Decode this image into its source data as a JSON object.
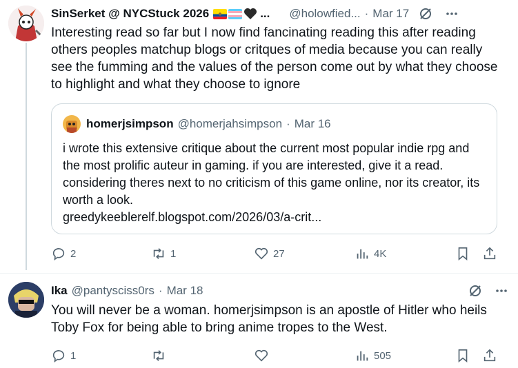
{
  "post1": {
    "display_name": "SinSerket @ NYCStuck 2026",
    "handle": "@holowfied...",
    "separator": "·",
    "time": "Mar 17",
    "text": "Interesting read so far but I now find fancinating reading this after reading others peoples matchup blogs or critques of media because you can really see the fumming and the values of the person come out by what they choose to highlight and what they choose to ignore",
    "quote": {
      "display_name": "homerjsimpson",
      "handle": "@homerjahsimpson",
      "separator": "·",
      "time": "Mar 16",
      "text": "i wrote this extensive critique about the current most popular indie rpg and the most prolific auteur in gaming. if you are interested, give it a read. considering theres next to no criticism of this game online, nor its creator, its worth a look.",
      "link": "greedykeeblerelf.blogspot.com/2026/03/a-crit..."
    },
    "actions": {
      "replies": "2",
      "reposts": "1",
      "likes": "27",
      "views": "4K"
    }
  },
  "post2": {
    "display_name": "Ika",
    "handle": "@pantysciss0rs",
    "separator": "·",
    "time": "Mar 18",
    "text": "You will never be a woman. homerjsimpson is an apostle of Hitler who heils Toby Fox for being able to bring anime tropes to the West.",
    "actions": {
      "replies": "1",
      "reposts": "",
      "likes": "",
      "views": "505"
    }
  },
  "colors": {
    "text": "#0f1419",
    "secondary": "#536471",
    "border": "#cfd9de"
  },
  "icons": [
    "reply-icon",
    "repost-icon",
    "like-icon",
    "views-icon",
    "bookmark-icon",
    "share-icon",
    "grok-icon",
    "more-icon"
  ]
}
